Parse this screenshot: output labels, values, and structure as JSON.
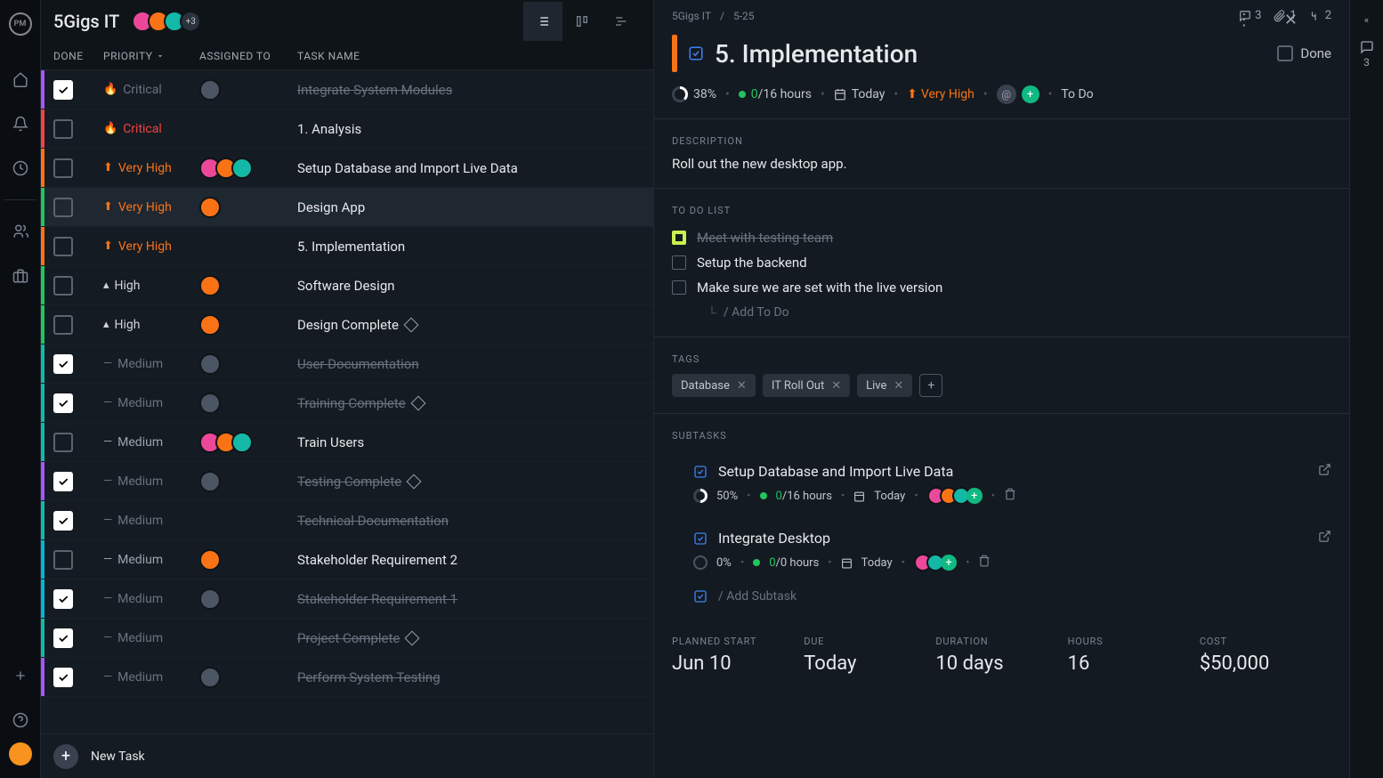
{
  "project": {
    "name": "5Gigs IT",
    "extra_avatars": "+3"
  },
  "columns": {
    "done": "DONE",
    "priority": "PRIORITY",
    "assigned": "ASSIGNED TO",
    "task": "TASK NAME"
  },
  "tasks": [
    {
      "done": true,
      "priority": "Critical",
      "pclass": "pr-done-gray",
      "picon": "🔥",
      "name": "Integrate System Modules",
      "color": "c-purple",
      "av": [
        "av-gray"
      ]
    },
    {
      "done": false,
      "priority": "Critical",
      "pclass": "pr-critical",
      "picon": "🔥",
      "name": "1. Analysis",
      "color": "c-red",
      "av": []
    },
    {
      "done": false,
      "priority": "Very High",
      "pclass": "pr-vhigh",
      "picon": "⬆",
      "name": "Setup Database and Import Live Data",
      "color": "c-orange",
      "av": [
        "av-pink",
        "av-orange",
        "av-teal"
      ]
    },
    {
      "done": false,
      "priority": "Very High",
      "pclass": "pr-vhigh",
      "picon": "⬆",
      "name": "Design App",
      "color": "c-green",
      "av": [
        "av-orange"
      ],
      "selected": true
    },
    {
      "done": false,
      "priority": "Very High",
      "pclass": "pr-vhigh",
      "picon": "⬆",
      "name": "5. Implementation",
      "color": "c-orange",
      "av": []
    },
    {
      "done": false,
      "priority": "High",
      "pclass": "pr-high",
      "picon": "▴",
      "name": "Software Design",
      "color": "c-green",
      "av": [
        "av-orange"
      ]
    },
    {
      "done": false,
      "priority": "High",
      "pclass": "pr-high",
      "picon": "▴",
      "name": "Design Complete",
      "color": "c-green",
      "av": [
        "av-orange"
      ],
      "milestone": true
    },
    {
      "done": true,
      "priority": "Medium",
      "pclass": "pr-done-gray",
      "picon": "—",
      "name": "User Documentation",
      "color": "c-teal",
      "av": [
        "av-gray"
      ]
    },
    {
      "done": true,
      "priority": "Medium",
      "pclass": "pr-done-gray",
      "picon": "—",
      "name": "Training Complete",
      "color": "c-teal",
      "av": [
        "av-gray"
      ],
      "milestone": true
    },
    {
      "done": false,
      "priority": "Medium",
      "pclass": "pr-medium",
      "picon": "—",
      "name": "Train Users",
      "color": "c-teal",
      "av": [
        "av-pink",
        "av-orange",
        "av-teal"
      ]
    },
    {
      "done": true,
      "priority": "Medium",
      "pclass": "pr-done-gray",
      "picon": "—",
      "name": "Testing Complete",
      "color": "c-purple",
      "av": [
        "av-gray"
      ],
      "milestone": true
    },
    {
      "done": true,
      "priority": "Medium",
      "pclass": "pr-done-gray",
      "picon": "—",
      "name": "Technical Documentation",
      "color": "c-teal",
      "av": []
    },
    {
      "done": false,
      "priority": "Medium",
      "pclass": "pr-medium",
      "picon": "—",
      "name": "Stakeholder Requirement 2",
      "color": "c-cyan",
      "av": [
        "av-orange"
      ]
    },
    {
      "done": true,
      "priority": "Medium",
      "pclass": "pr-done-gray",
      "picon": "—",
      "name": "Stakeholder Requirement 1",
      "color": "c-cyan",
      "av": [
        "av-gray"
      ]
    },
    {
      "done": true,
      "priority": "Medium",
      "pclass": "pr-done-gray",
      "picon": "—",
      "name": "Project Complete",
      "color": "c-teal",
      "av": [],
      "milestone": true
    },
    {
      "done": true,
      "priority": "Medium",
      "pclass": "pr-done-gray",
      "picon": "—",
      "name": "Perform System Testing",
      "color": "c-purple",
      "av": [
        "av-gray"
      ]
    }
  ],
  "newtask": "New Task",
  "detail": {
    "breadcrumb": {
      "project": "5Gigs IT",
      "id": "5-25"
    },
    "counts": {
      "comments": "3",
      "attachments": "1",
      "subtasks": "2"
    },
    "title": "5. Implementation",
    "done_label": "Done",
    "meta": {
      "progress": "38%",
      "hours": "0/16 hours",
      "date": "Today",
      "priority": "Very High",
      "status": "To Do"
    },
    "description_label": "DESCRIPTION",
    "description": "Roll out the new desktop app.",
    "todo_label": "TO DO LIST",
    "todos": [
      {
        "done": true,
        "text": "Meet with testing team"
      },
      {
        "done": false,
        "text": "Setup the backend"
      },
      {
        "done": false,
        "text": "Make sure we are set with the live version"
      }
    ],
    "add_todo": "/ Add To Do",
    "tags_label": "TAGS",
    "tags": [
      "Database",
      "IT Roll Out",
      "Live"
    ],
    "subtasks_label": "SUBTASKS",
    "subtasks": [
      {
        "name": "Setup Database and Import Live Data",
        "progress": "50%",
        "hours": "0/16 hours",
        "date": "Today",
        "av": [
          "av-pink",
          "av-orange",
          "av-teal"
        ]
      },
      {
        "name": "Integrate Desktop",
        "progress": "0%",
        "hours": "0/0 hours",
        "date": "Today",
        "av": [
          "av-pink",
          "av-teal"
        ]
      }
    ],
    "add_subtask": "/ Add Subtask",
    "footer": {
      "planned_start_label": "PLANNED START",
      "planned_start": "Jun 10",
      "due_label": "DUE",
      "due": "Today",
      "duration_label": "DURATION",
      "duration": "10 days",
      "hours_label": "HOURS",
      "hours": "16",
      "cost_label": "COST",
      "cost": "$50,000"
    }
  },
  "right_strip": {
    "chevron": "«",
    "comments": "3"
  }
}
